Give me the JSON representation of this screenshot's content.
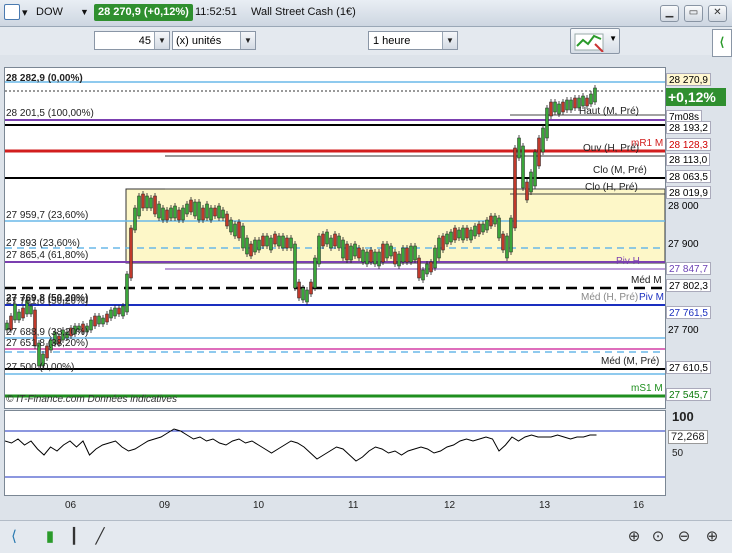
{
  "window": {
    "symbol": "DOW",
    "last_change": "28 270,9 (+0,12%)",
    "time": "11:52:51",
    "instrument": "Wall Street Cash (1€)"
  },
  "toolbar": {
    "quantity": "45",
    "unit_mode": "(x) unités",
    "timeframe": "1 heure"
  },
  "chart": {
    "top_label": "28 282,9 (0,00%)",
    "watermark": "© IT-Finance.com  Données indicatives",
    "fib_labels": [
      "28 201,5 (100,00%)",
      "27 959,7 (23,60%)",
      "27 893 (23,60%)",
      "27 865,4 (61,80%)",
      "27 769,8 (50,20%)",
      "27 761,6 (50,20%)",
      "27 688,9 (38,20%)",
      "27 651,8 (38,20%)",
      "27 500 (0,00%)"
    ],
    "line_labels": {
      "haut": "Haut (M, Pré)",
      "mr1": "mR1 M",
      "ouv": "Ouv (H, Pré)",
      "clo_m": "Clo (M, Pré)",
      "clo_h": "Clo (H, Pré)",
      "piv_h": "Piv H",
      "med_m": "Méd M",
      "med_h": "Méd (H, Pré)",
      "piv_m": "Piv M",
      "med_m_pre": "Méd (M, Pré)",
      "ms1": "mS1 M"
    },
    "price_labels": [
      {
        "text": "28 270,9",
        "bg": "#fff7d0",
        "fg": "#000"
      },
      {
        "text": "+0,12%",
        "bg": "#2f8f2f",
        "fg": "#fff"
      },
      {
        "text": "7m08s",
        "bg": "#ffffff",
        "fg": "#000"
      },
      {
        "text": "28 193,2",
        "bg": "#ffffff",
        "fg": "#000"
      },
      {
        "text": "28 128,3",
        "bg": "#ffffff",
        "fg": "#d00000"
      },
      {
        "text": "28 113,0",
        "bg": "#ffffff",
        "fg": "#000"
      },
      {
        "text": "28 063,5",
        "bg": "#ffffff",
        "fg": "#000"
      },
      {
        "text": "28 019,9",
        "bg": "#ffffff",
        "fg": "#000"
      },
      {
        "text": "28 000",
        "bg": "#ffffff",
        "fg": "#000"
      },
      {
        "text": "27 900",
        "bg": "#ffffff",
        "fg": "#000"
      },
      {
        "text": "27 847,7",
        "bg": "#ffffff",
        "fg": "#6a3fb5"
      },
      {
        "text": "27 802,3",
        "bg": "#ffffff",
        "fg": "#000"
      },
      {
        "text": "27 761,5",
        "bg": "#ffffff",
        "fg": "#1a2fbf"
      },
      {
        "text": "27 700",
        "bg": "#ffffff",
        "fg": "#000"
      },
      {
        "text": "27 610,5",
        "bg": "#ffffff",
        "fg": "#000"
      },
      {
        "text": "27 545,7",
        "bg": "#ffffff",
        "fg": "#0a7a0a"
      }
    ]
  },
  "rsi": {
    "levels": [
      "100",
      "50"
    ],
    "value": "72,268"
  },
  "xaxis": {
    "labels": [
      "06",
      "09",
      "10",
      "11",
      "12",
      "13",
      "16"
    ]
  },
  "colors": {
    "up": "#3aa63a",
    "down": "#c0392b",
    "fib_zone": "#fdf7c8"
  }
}
